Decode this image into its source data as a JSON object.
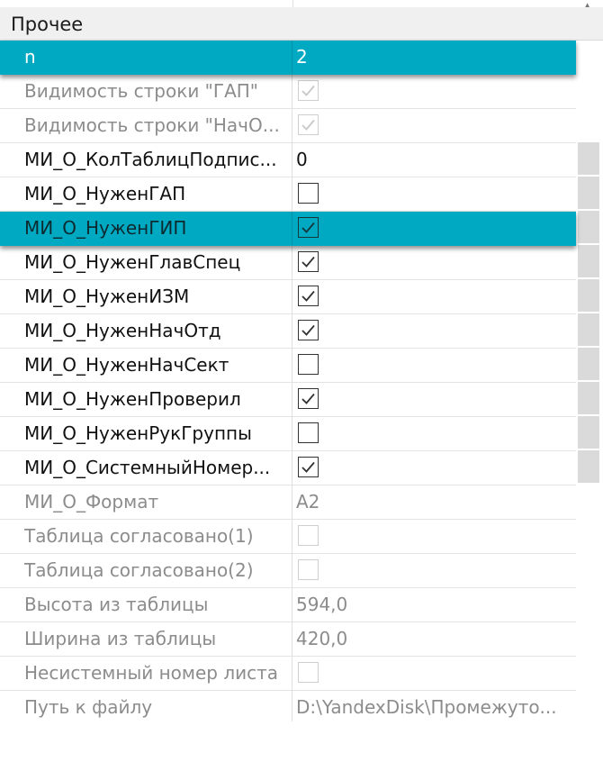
{
  "category": {
    "label": "Прочее"
  },
  "scroll_arrow": "▲",
  "rows": [
    {
      "name": "n",
      "value": "2",
      "type": "text",
      "state": "selected"
    },
    {
      "name": "Видимость строки \"ГАП\"",
      "value": "",
      "type": "checkbox",
      "checked": true,
      "state": "disabled"
    },
    {
      "name": "Видимость строки \"НачО...",
      "value": "",
      "type": "checkbox",
      "checked": true,
      "state": "disabled"
    },
    {
      "name": "МИ_О_КолТаблицПодпис...",
      "value": "0",
      "type": "text",
      "state": "normal"
    },
    {
      "name": "МИ_О_НуженГАП",
      "value": "",
      "type": "checkbox",
      "checked": false,
      "state": "normal"
    },
    {
      "name": "МИ_О_НуженГИП",
      "value": "",
      "type": "checkbox",
      "checked": true,
      "state": "selected"
    },
    {
      "name": "МИ_О_НуженГлавСпец",
      "value": "",
      "type": "checkbox",
      "checked": true,
      "state": "normal"
    },
    {
      "name": "МИ_О_НуженИЗМ",
      "value": "",
      "type": "checkbox",
      "checked": true,
      "state": "normal"
    },
    {
      "name": "МИ_О_НуженНачОтд",
      "value": "",
      "type": "checkbox",
      "checked": true,
      "state": "normal"
    },
    {
      "name": "МИ_О_НуженНачСект",
      "value": "",
      "type": "checkbox",
      "checked": false,
      "state": "normal"
    },
    {
      "name": "МИ_О_НуженПроверил",
      "value": "",
      "type": "checkbox",
      "checked": true,
      "state": "normal"
    },
    {
      "name": "МИ_О_НуженРукГруппы",
      "value": "",
      "type": "checkbox",
      "checked": false,
      "state": "normal"
    },
    {
      "name": "МИ_О_СистемныйНомер...",
      "value": "",
      "type": "checkbox",
      "checked": true,
      "state": "normal"
    },
    {
      "name": "МИ_О_Формат",
      "value": "A2",
      "type": "text",
      "state": "disabled"
    },
    {
      "name": "Таблица согласовано(1)",
      "value": "",
      "type": "checkbox",
      "checked": false,
      "state": "disabled"
    },
    {
      "name": "Таблица согласовано(2)",
      "value": "",
      "type": "checkbox",
      "checked": false,
      "state": "disabled"
    },
    {
      "name": "Высота из таблицы",
      "value": "594,0",
      "type": "text",
      "state": "disabled"
    },
    {
      "name": "Ширина из таблицы",
      "value": "420,0",
      "type": "text",
      "state": "disabled"
    },
    {
      "name": "Несистемный номер листа",
      "value": "",
      "type": "checkbox",
      "checked": false,
      "state": "disabled"
    },
    {
      "name": "Путь к файлу",
      "value": "D:\\YandexDisk\\Промежуто...",
      "type": "text",
      "state": "disabled"
    }
  ],
  "colors": {
    "selection": "#00a9c2",
    "category_bg": "#f0f0f0",
    "disabled_text": "#8c8c8c"
  }
}
